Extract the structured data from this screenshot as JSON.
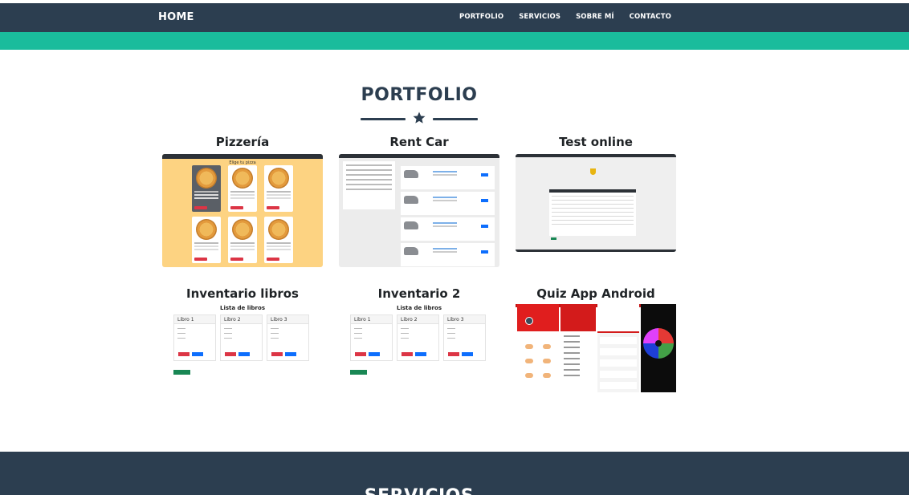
{
  "navbar": {
    "brand": "HOME",
    "links": [
      "PORTFOLIO",
      "SERVICIOS",
      "SOBRE MÍ",
      "CONTACTO"
    ],
    "bg_color": "#2c3e50",
    "accent_color": "#1abc9c"
  },
  "portfolio": {
    "title": "PORTFOLIO",
    "divider_icon": "star-icon",
    "projects": [
      {
        "title": "Pizzería",
        "thumbnail": "pizzeria-screenshot"
      },
      {
        "title": "Rent Car",
        "thumbnail": "rent-car-screenshot"
      },
      {
        "title": "Test online",
        "thumbnail": "test-online-screenshot"
      },
      {
        "title": "Inventario libros",
        "thumbnail": "inventario-libros-screenshot"
      },
      {
        "title": "Inventario 2",
        "thumbnail": "inventario-2-screenshot"
      },
      {
        "title": "Quiz App Android",
        "thumbnail": "quiz-app-screenshot"
      }
    ]
  },
  "thumbs": {
    "pizza_header": "Elige tu pizza",
    "inv_header": "Lista de libros",
    "books": [
      "Libro 1",
      "Libro 2",
      "Libro 3"
    ]
  },
  "next_section": {
    "title": "SERVICIOS"
  }
}
